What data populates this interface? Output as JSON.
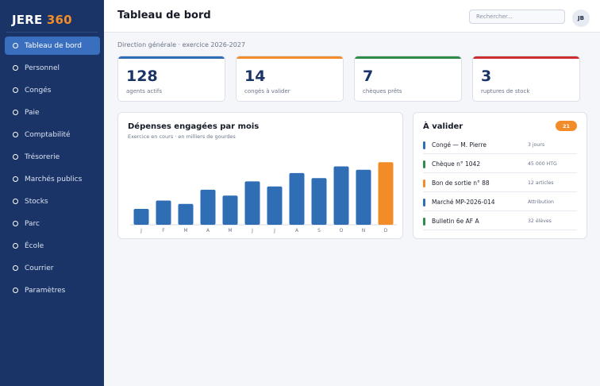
{
  "app": {
    "logo_main": "JERE ",
    "logo_accent": "360"
  },
  "sidebar": {
    "items": [
      {
        "label": "Tableau de bord",
        "active": true
      },
      {
        "label": "Personnel"
      },
      {
        "label": "Congés"
      },
      {
        "label": "Paie"
      },
      {
        "label": "Comptabilité"
      },
      {
        "label": "Trésorerie"
      },
      {
        "label": "Marchés publics"
      },
      {
        "label": "Stocks"
      },
      {
        "label": "Parc"
      },
      {
        "label": "École"
      },
      {
        "label": "Courrier"
      },
      {
        "label": "Paramètres"
      }
    ]
  },
  "header": {
    "title": "Tableau de bord",
    "search_placeholder": "Rechercher...",
    "avatar_initials": "JB"
  },
  "subtitle": "Direction générale · exercice 2026-2027",
  "kpis": [
    {
      "value": "128",
      "label": "agents actifs",
      "color": "#2f6eb5"
    },
    {
      "value": "14",
      "label": "congés à valider",
      "color": "#f28c28"
    },
    {
      "value": "7",
      "label": "chèques prêts",
      "color": "#2e8b4a"
    },
    {
      "value": "3",
      "label": "ruptures de stock",
      "color": "#cc2e2e"
    }
  ],
  "chart": {
    "title": "Dépenses engagées par mois",
    "subtitle": "Exercice en cours · en milliers de gourdes"
  },
  "chart_data": {
    "type": "bar",
    "categories": [
      "J",
      "F",
      "M",
      "A",
      "M",
      "J",
      "J",
      "A",
      "S",
      "O",
      "N",
      "D"
    ],
    "values": [
      19,
      29,
      25,
      42,
      35,
      52,
      46,
      62,
      56,
      70,
      66,
      75
    ],
    "ylim": [
      0,
      80
    ],
    "highlight_index": 11,
    "bar_color": "#2f6eb5",
    "highlight_color": "#f28c28",
    "grid": false
  },
  "validation": {
    "title": "À valider",
    "count": "21",
    "items": [
      {
        "name": "Congé — M. Pierre",
        "meta": "3 jours",
        "color": "#2f6eb5"
      },
      {
        "name": "Chèque n° 1042",
        "meta": "45 000 HTG",
        "color": "#2e8b4a"
      },
      {
        "name": "Bon de sortie n° 88",
        "meta": "12 articles",
        "color": "#f28c28"
      },
      {
        "name": "Marché MP-2026-014",
        "meta": "Attribution",
        "color": "#2f6eb5"
      },
      {
        "name": "Bulletin 6e AF A",
        "meta": "32 élèves",
        "color": "#2e8b4a"
      }
    ]
  }
}
